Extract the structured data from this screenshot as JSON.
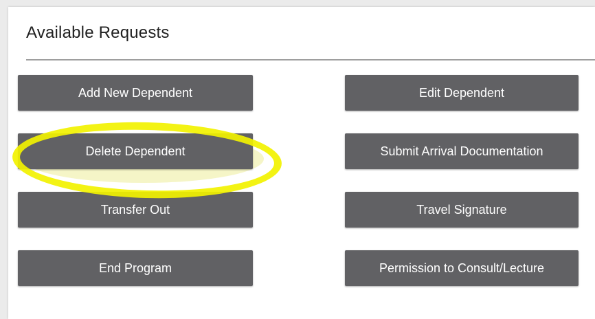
{
  "panel": {
    "title": "Available Requests"
  },
  "buttons": {
    "add_new_dependent": "Add New Dependent",
    "edit_dependent": "Edit Dependent",
    "delete_dependent": "Delete Dependent",
    "submit_arrival_documentation": "Submit Arrival Documentation",
    "transfer_out": "Transfer Out",
    "travel_signature": "Travel Signature",
    "end_program": "End Program",
    "permission_to_consult_lecture": "Permission to Consult/Lecture"
  },
  "colors": {
    "button_bg": "#616164",
    "button_text": "#ffffff",
    "title_text": "#212121",
    "divider": "#9e9e9e",
    "highlight": "#f2f200"
  }
}
